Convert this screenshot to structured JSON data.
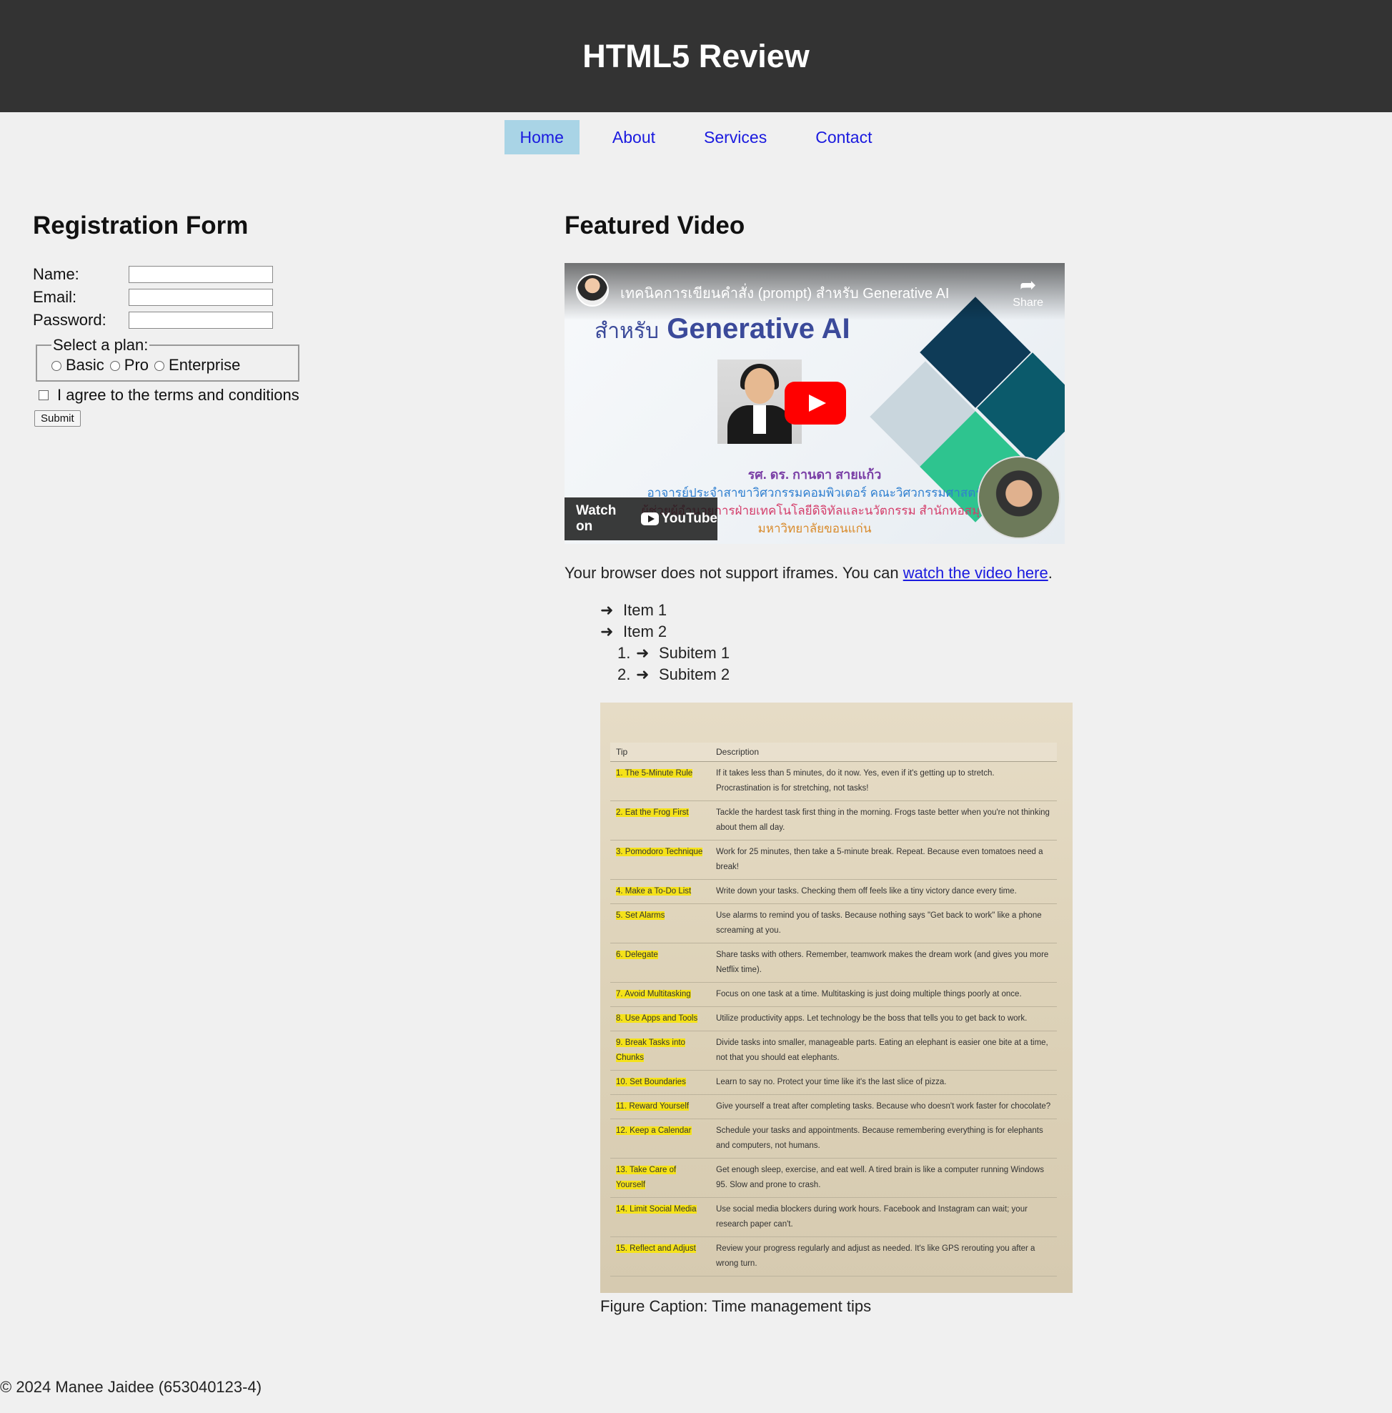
{
  "header": {
    "title": "HTML5 Review"
  },
  "nav": {
    "items": [
      {
        "label": "Home",
        "active": true
      },
      {
        "label": "About"
      },
      {
        "label": "Services"
      },
      {
        "label": "Contact"
      }
    ]
  },
  "form": {
    "title": "Registration Form",
    "name_label": "Name:",
    "email_label": "Email:",
    "password_label": "Password:",
    "name_value": "",
    "email_value": "",
    "password_value": "",
    "plan_legend": "Select a plan:",
    "plans": [
      "Basic",
      "Pro",
      "Enterprise"
    ],
    "agree_label": "I agree to the terms and conditions",
    "agree_checked": false,
    "submit_label": "Submit"
  },
  "video": {
    "section_title": "Featured Video",
    "video_title": "เทคนิคการเขียนคำสั่ง (prompt) สำหรับ Generative AI",
    "share_label": "Share",
    "thumb_line1": "สำหรับ",
    "thumb_line2": "Generative AI",
    "credit_name": "รศ. ดร. กานดา สายแก้ว",
    "credit_line2": "อาจารย์ประจำสาขาวิศวกรรมคอมพิวเตอร์ คณะวิศวกรรมศาสตร์",
    "credit_line3": "ผู้ช่วยผู้อำนวยการฝ่ายเทคโนโลยีดิจิทัลและนวัตกรรม สำนักหอสมุด",
    "credit_line4": "มหาวิทยาลัยขอนแก่น",
    "watch_on": "Watch on",
    "youtube": "YouTube",
    "note_text": "Your browser does not support iframes. You can ",
    "note_link": "watch the video here",
    "note_end": "."
  },
  "list": {
    "arrow": "➜",
    "item1": "Item 1",
    "item2": "Item 2",
    "sub1_num": "1.",
    "sub1": "Subitem 1",
    "sub2_num": "2.",
    "sub2": "Subitem 2"
  },
  "figure": {
    "caption": "Figure Caption: Time management tips",
    "col_tip": "Tip",
    "col_desc": "Description",
    "rows": [
      {
        "tip": "1. The 5-Minute Rule",
        "desc": "If it takes less than 5 minutes, do it now. Yes, even if it's getting up to stretch. Procrastination is for stretching, not tasks!"
      },
      {
        "tip": "2. Eat the Frog First",
        "desc": "Tackle the hardest task first thing in the morning. Frogs taste better when you're not thinking about them all day."
      },
      {
        "tip": "3. Pomodoro Technique",
        "desc": "Work for 25 minutes, then take a 5-minute break. Repeat. Because even tomatoes need a break!"
      },
      {
        "tip": "4. Make a To-Do List",
        "desc": "Write down your tasks. Checking them off feels like a tiny victory dance every time."
      },
      {
        "tip": "5. Set Alarms",
        "desc": "Use alarms to remind you of tasks. Because nothing says \"Get back to work\" like a phone screaming at you."
      },
      {
        "tip": "6. Delegate",
        "desc": "Share tasks with others. Remember, teamwork makes the dream work (and gives you more Netflix time)."
      },
      {
        "tip": "7. Avoid Multitasking",
        "desc": "Focus on one task at a time. Multitasking is just doing multiple things poorly at once."
      },
      {
        "tip": "8. Use Apps and Tools",
        "desc": "Utilize productivity apps. Let technology be the boss that tells you to get back to work."
      },
      {
        "tip": "9. Break Tasks into Chunks",
        "desc": "Divide tasks into smaller, manageable parts. Eating an elephant is easier one bite at a time, not that you should eat elephants."
      },
      {
        "tip": "10. Set Boundaries",
        "desc": "Learn to say no. Protect your time like it's the last slice of pizza."
      },
      {
        "tip": "11. Reward Yourself",
        "desc": "Give yourself a treat after completing tasks. Because who doesn't work faster for chocolate?"
      },
      {
        "tip": "12. Keep a Calendar",
        "desc": "Schedule your tasks and appointments. Because remembering everything is for elephants and computers, not humans."
      },
      {
        "tip": "13. Take Care of Yourself",
        "desc": "Get enough sleep, exercise, and eat well. A tired brain is like a computer running Windows 95. Slow and prone to crash."
      },
      {
        "tip": "14. Limit Social Media",
        "desc": "Use social media blockers during work hours. Facebook and Instagram can wait; your research paper can't."
      },
      {
        "tip": "15. Reflect and Adjust",
        "desc": "Review your progress regularly and adjust as needed. It's like GPS rerouting you after a wrong turn."
      }
    ]
  },
  "footer": {
    "text": "© 2024 Manee Jaidee (653040123-4)"
  }
}
